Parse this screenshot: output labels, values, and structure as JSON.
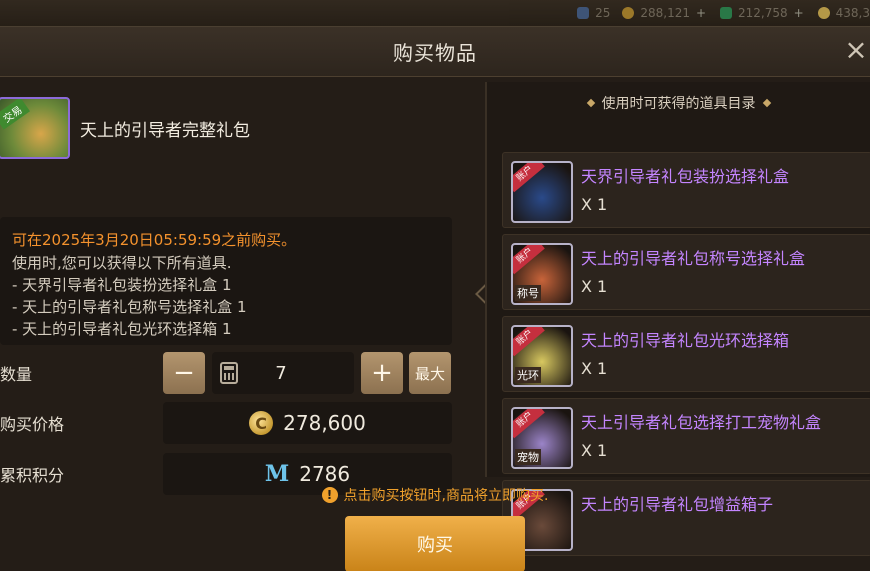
{
  "topbar": {
    "values": [
      "25",
      "288,121",
      "212,758",
      "438,3"
    ]
  },
  "dialog": {
    "title": "购买物品",
    "close_icon": "close-icon"
  },
  "item": {
    "name": "天上的引导者完整礼包",
    "tag": "交易",
    "deadline": "可在2025年3月20日05:59:59之前购买。",
    "desc_intro": "使用时,您可以获得以下所有道具.",
    "desc_lines": [
      " - 天界引导者礼包装扮选择礼盒 1",
      " - 天上的引导者礼包称号选择礼盒 1",
      " - 天上的引导者礼包光环选择箱 1"
    ]
  },
  "quantity": {
    "label": "数量",
    "value": "7",
    "minus": "−",
    "plus": "+",
    "max": "最大"
  },
  "price": {
    "label": "购买价格",
    "value": "278,600",
    "coin_symbol": "C"
  },
  "points": {
    "label": "累积积分",
    "value": "2786",
    "symbol": "M"
  },
  "rewards": {
    "title": "使用时可获得的道具目录",
    "items": [
      {
        "name": "天界引导者礼包装扮选择礼盒",
        "count": "X 1",
        "corner": "账户",
        "label": "",
        "color": "#2a4a8a"
      },
      {
        "name": "天上的引导者礼包称号选择礼盒",
        "count": "X 1",
        "corner": "账户",
        "label": "称号",
        "color": "#c8643a"
      },
      {
        "name": "天上的引导者礼包光环选择箱",
        "count": "X 1",
        "corner": "账户",
        "label": "光环",
        "color": "#d8c860"
      },
      {
        "name": "天上引导者礼包选择打工宠物礼盒",
        "count": "X 1",
        "corner": "账户",
        "label": "宠物",
        "color": "#9b84c8"
      },
      {
        "name": "天上的引导者礼包增益箱子",
        "count": "",
        "corner": "账户",
        "label": "",
        "color": "#6a4a3a"
      }
    ]
  },
  "footer": {
    "notice": "点击购买按钮时,商品将立即购买.",
    "buy_label": "购买"
  }
}
